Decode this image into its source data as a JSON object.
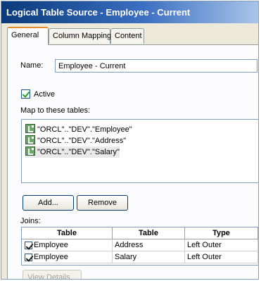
{
  "window": {
    "title": "Logical Table Source - Employee - Current"
  },
  "tabs": [
    {
      "label": "General"
    },
    {
      "label": "Column Mapping"
    },
    {
      "label": "Content"
    }
  ],
  "general": {
    "name_label": "Name:",
    "name_value": "Employee - Current",
    "active_label": "Active",
    "active_checked": true,
    "map_label": "Map to these tables:",
    "tables": [
      "\"ORCL\"..\"DEV\".\"Employee\"",
      "\"ORCL\"..\"DEV\".\"Address\"",
      "\"ORCL\"..\"DEV\".\"Salary\""
    ],
    "add_button": "Add...",
    "remove_button": "Remove",
    "joins_label": "Joins:",
    "joins_headers": [
      "Table",
      "Table",
      "Type"
    ],
    "joins_rows": [
      [
        "Employee",
        "Address",
        "Left Outer"
      ],
      [
        "Employee",
        "Salary",
        "Left Outer"
      ]
    ],
    "view_details_button": "View Details..."
  },
  "colors": {
    "title_start": "#0a3a7a",
    "title_end": "#a9c4ea",
    "tab_accent": "#e68b2c"
  }
}
